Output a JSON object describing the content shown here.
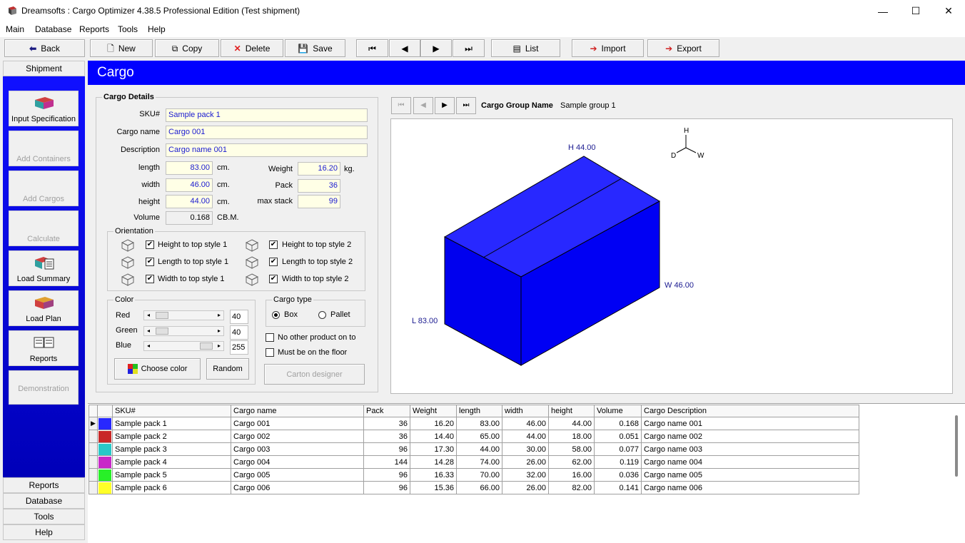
{
  "window": {
    "title": "Dreamsofts : Cargo Optimizer 4.38.5 Professional Edition  (Test shipment)",
    "controls": [
      "—",
      "☐",
      "✕"
    ]
  },
  "menu": [
    "Main",
    "Database",
    "Reports",
    "Tools",
    "Help"
  ],
  "toolbar": {
    "back": "Back",
    "new": "New",
    "copy": "Copy",
    "delete": "Delete",
    "save": "Save",
    "first": "⏮",
    "prev": "◀",
    "next": "▶",
    "last": "⏭",
    "list": "List",
    "import": "Import",
    "export": "Export"
  },
  "nav": {
    "tab": "Shipment",
    "items": [
      {
        "label": "Input Specification",
        "enabled": true
      },
      {
        "label": "Add Containers",
        "enabled": false
      },
      {
        "label": "Add Cargos",
        "enabled": false
      },
      {
        "label": "Calculate",
        "enabled": false
      },
      {
        "label": "Load Summary",
        "enabled": true
      },
      {
        "label": "Load Plan",
        "enabled": true
      },
      {
        "label": "Reports",
        "enabled": true
      },
      {
        "label": "Demonstration",
        "enabled": false
      }
    ],
    "bottom": [
      "Reports",
      "Database",
      "Tools",
      "Help"
    ]
  },
  "header": {
    "title": "Cargo"
  },
  "details": {
    "legend": "Cargo Details",
    "sku_label": "SKU#",
    "sku": "Sample pack 1",
    "name_label": "Cargo name",
    "name": "Cargo 001",
    "desc_label": "Description",
    "desc": "Cargo name 001",
    "length_label": "length",
    "length": "83.00",
    "width_label": "width",
    "width": "46.00",
    "height_label": "height",
    "height": "44.00",
    "volume_label": "Volume",
    "volume": "0.168",
    "unit_cm": "cm.",
    "unit_cbm": "CB.M.",
    "weight_label": "Weight",
    "weight": "16.20",
    "unit_kg": "kg.",
    "pack_label": "Pack",
    "pack": "36",
    "maxstack_label": "max stack",
    "maxstack": "99"
  },
  "orientation": {
    "legend": "Orientation",
    "options": [
      {
        "label": "Height to top style 1",
        "checked": true
      },
      {
        "label": "Height to top style 2",
        "checked": true
      },
      {
        "label": "Length to top style 1",
        "checked": true
      },
      {
        "label": "Length to top style 2",
        "checked": true
      },
      {
        "label": "Width to top style 1",
        "checked": true
      },
      {
        "label": "Width to top style 2",
        "checked": true
      }
    ],
    "check": "✔"
  },
  "color": {
    "legend": "Color",
    "red_label": "Red",
    "red": "40",
    "green_label": "Green",
    "green": "40",
    "blue_label": "Blue",
    "blue": "255",
    "red_level": 0.157,
    "green_level": 0.157,
    "blue_level": 1.0,
    "choose": "Choose color",
    "random": "Random"
  },
  "cargo_type": {
    "legend": "Cargo type",
    "box": "Box",
    "pallet": "Pallet",
    "selected": "Box",
    "no_other": "No other product on to",
    "floor": "Must be on the floor",
    "carton": "Carton designer"
  },
  "group": {
    "label": "Cargo Group Name",
    "name": "Sample group 1",
    "nav": [
      "⏮",
      "◀",
      "▶",
      "⏭"
    ]
  },
  "view": {
    "color": "#2828ff",
    "h": "H 44.00",
    "w": "W 46.00",
    "l": "L 83.00",
    "axis_h": "H",
    "axis_d": "D",
    "axis_w": "W"
  },
  "grid": {
    "headers": [
      "SKU#",
      "Cargo name",
      "Pack",
      "Weight",
      "length",
      "width",
      "height",
      "Volume",
      "Cargo Description"
    ],
    "rows": [
      {
        "color": "#2828ff",
        "sku": "Sample pack 1",
        "name": "Cargo 001",
        "pack": "36",
        "weight": "16.20",
        "length": "83.00",
        "width": "46.00",
        "height": "44.00",
        "volume": "0.168",
        "desc": "Cargo name 001"
      },
      {
        "color": "#c82828",
        "sku": "Sample pack 2",
        "name": "Cargo 002",
        "pack": "36",
        "weight": "14.40",
        "length": "65.00",
        "width": "44.00",
        "height": "18.00",
        "volume": "0.051",
        "desc": "Cargo name 002"
      },
      {
        "color": "#28c8c8",
        "sku": "Sample pack 3",
        "name": "Cargo 003",
        "pack": "96",
        "weight": "17.30",
        "length": "44.00",
        "width": "30.00",
        "height": "58.00",
        "volume": "0.077",
        "desc": "Cargo name 003"
      },
      {
        "color": "#c828c8",
        "sku": "Sample pack 4",
        "name": "Cargo 004",
        "pack": "144",
        "weight": "14.28",
        "length": "74.00",
        "width": "26.00",
        "height": "62.00",
        "volume": "0.119",
        "desc": "Cargo name 004"
      },
      {
        "color": "#28f028",
        "sku": "Sample pack 5",
        "name": "Cargo 005",
        "pack": "96",
        "weight": "16.33",
        "length": "70.00",
        "width": "32.00",
        "height": "16.00",
        "volume": "0.036",
        "desc": "Cargo name 005"
      },
      {
        "color": "#ffff28",
        "sku": "Sample pack 6",
        "name": "Cargo 006",
        "pack": "96",
        "weight": "15.36",
        "length": "66.00",
        "width": "26.00",
        "height": "82.00",
        "volume": "0.141",
        "desc": "Cargo name 006"
      }
    ],
    "row_marker": "▶"
  }
}
